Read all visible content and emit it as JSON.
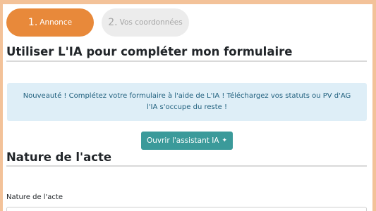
{
  "stepper": {
    "steps": [
      {
        "number": "1.",
        "label": "Annonce",
        "active": true
      },
      {
        "number": "2.",
        "label": "Vos coordonnées",
        "active": false
      }
    ]
  },
  "ai_section": {
    "title": "Utiliser L'IA pour compléter mon formulaire",
    "notice": "Nouveauté ! Complétez votre formulaire à l'aide de L'IA ! Téléchargez vos statuts ou PV d'AG l'IA s'occupe du reste !",
    "button_label": "Ouvrir l'assistant IA",
    "button_icon": "sparkle-icon"
  },
  "act_section": {
    "title": "Nature de l'acte",
    "field_label": "Nature de l'acte",
    "field_value": ""
  },
  "colors": {
    "page_background": "#f3c299",
    "step_active": "#e8893a",
    "step_inactive": "#ececec",
    "notice_background": "#deeef7",
    "notice_text": "#1f5f7d",
    "button_background": "#3b9a9a"
  }
}
